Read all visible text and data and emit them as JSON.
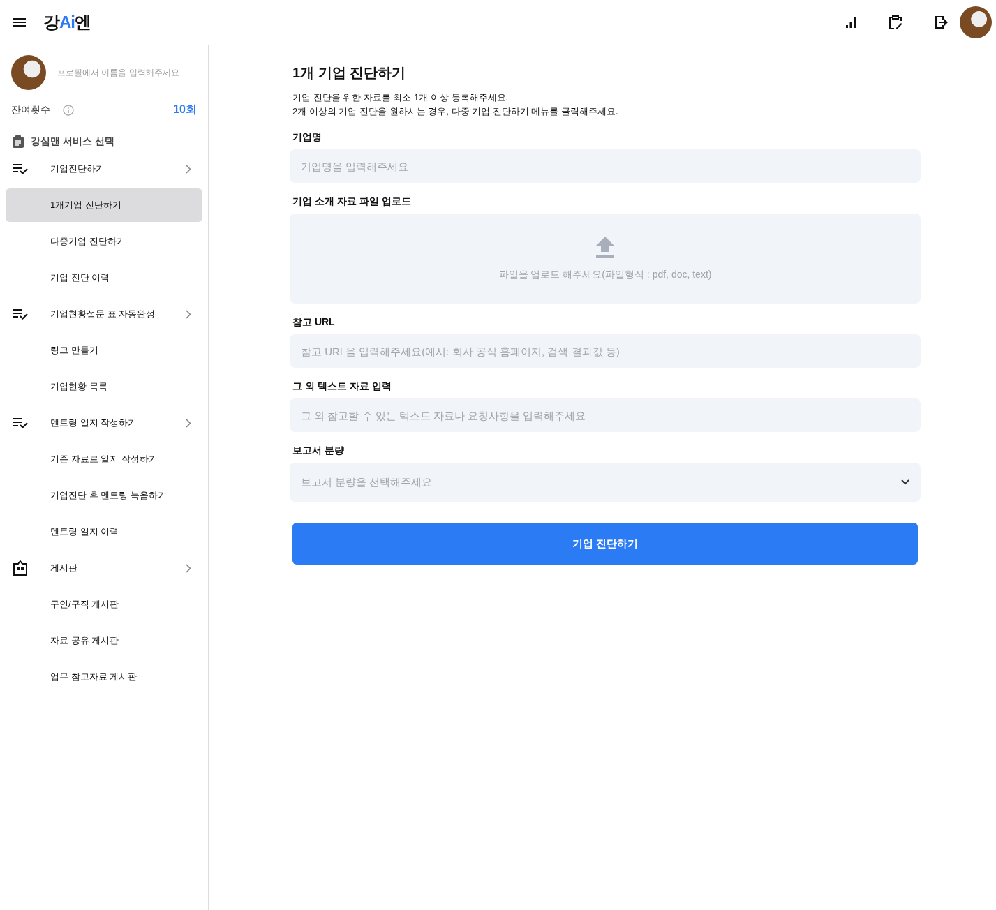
{
  "header": {
    "logo": [
      {
        "text": "강",
        "accent": false
      },
      {
        "text": "Ai",
        "accent": true
      },
      {
        "text": "엔",
        "accent": false
      }
    ]
  },
  "sidebar": {
    "profile_name_placeholder": "프로필에서 이름을 입력해주세요",
    "remaining_label": "잔여횟수",
    "remaining_value": "10회",
    "section_title": "강심맨 서비스 선택",
    "items": [
      {
        "kind": "group",
        "label": "기업진단하기",
        "selected": false
      },
      {
        "kind": "sub",
        "label": "1개기업 진단하기",
        "selected": true
      },
      {
        "kind": "sub",
        "label": "다중기업 진단하기",
        "selected": false
      },
      {
        "kind": "sub",
        "label": "기업 진단 이력",
        "selected": false
      },
      {
        "kind": "group",
        "label": "기업현황설문 표 자동완성",
        "selected": false
      },
      {
        "kind": "sub",
        "label": "링크 만들기",
        "selected": false
      },
      {
        "kind": "sub",
        "label": "기업현황 목록",
        "selected": false
      },
      {
        "kind": "group",
        "label": "멘토링 일지 작성하기",
        "selected": false
      },
      {
        "kind": "sub",
        "label": "기존 자료로 일지 작성하기",
        "selected": false
      },
      {
        "kind": "sub",
        "label": "기업진단 후 멘토링 녹음하기",
        "selected": false
      },
      {
        "kind": "sub",
        "label": "멘토링 일지 이력",
        "selected": false
      },
      {
        "kind": "board-group",
        "label": "게시판",
        "selected": false
      },
      {
        "kind": "sub",
        "label": "구인/구직 게시판",
        "selected": false
      },
      {
        "kind": "sub",
        "label": "자료 공유 게시판",
        "selected": false
      },
      {
        "kind": "sub",
        "label": "업무 참고자료 게시판",
        "selected": false
      }
    ]
  },
  "main": {
    "title": "1개 기업 진단하기",
    "description": [
      "기업 진단을 위한 자료를 최소 1개 이상 등록해주세요.",
      "2개 이상의 기업 진단을 원하시는 경우, 다중 기업 진단하기 메뉴를 클릭해주세요."
    ],
    "fields": [
      {
        "kind": "input",
        "label": "기업명",
        "placeholder": "기업명을 입력해주세요"
      },
      {
        "kind": "upload",
        "label": "기업 소개 자료 파일 업로드",
        "placeholder": "파일을 업로드 해주세요(파일형식 : pdf, doc, text)"
      },
      {
        "kind": "input",
        "label": "참고 URL",
        "placeholder": "참고 URL을 입력해주세요(예시: 회사 공식 홈페이지, 검색 결과값 등)"
      },
      {
        "kind": "input",
        "label": "그 외 텍스트 자료 입력",
        "placeholder": "그 외 참고할 수 있는 텍스트 자료나 요청사항을 입력해주세요"
      },
      {
        "kind": "select",
        "label": "보고서 분량",
        "placeholder": "보고서 분량을 선택해주세요"
      }
    ],
    "submit": "기업 진단하기"
  }
}
